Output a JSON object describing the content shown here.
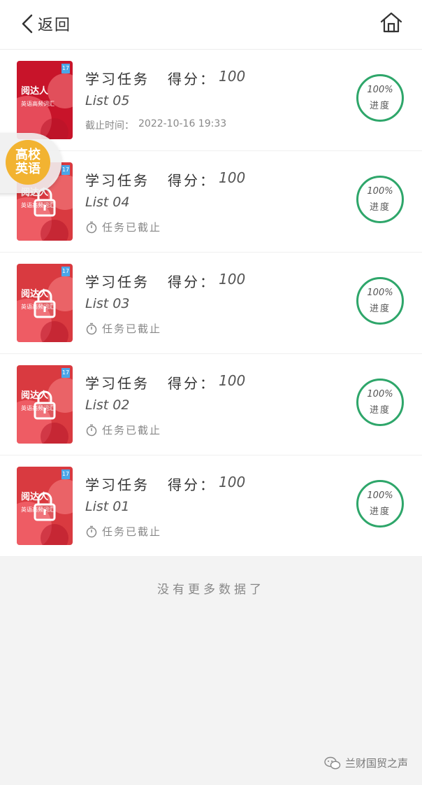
{
  "header": {
    "back_label": "返回"
  },
  "badge": {
    "line1": "高校",
    "line2": "英语"
  },
  "cover": {
    "brand": "阅达人",
    "subtitle": "英语高频词汇",
    "tag": "17"
  },
  "items": [
    {
      "title": "学习任务",
      "score_label": "得分：",
      "score_value": "100",
      "list_name": "List 05",
      "deadline_label": "截止时间：",
      "deadline_value": "2022-10-16 19:33",
      "progress_pct": "100%",
      "progress_label": "进度",
      "locked": false
    },
    {
      "title": "学习任务",
      "score_label": "得分：",
      "score_value": "100",
      "list_name": "List 04",
      "status": "任务已截止",
      "progress_pct": "100%",
      "progress_label": "进度",
      "locked": true
    },
    {
      "title": "学习任务",
      "score_label": "得分：",
      "score_value": "100",
      "list_name": "List 03",
      "status": "任务已截止",
      "progress_pct": "100%",
      "progress_label": "进度",
      "locked": true
    },
    {
      "title": "学习任务",
      "score_label": "得分：",
      "score_value": "100",
      "list_name": "List 02",
      "status": "任务已截止",
      "progress_pct": "100%",
      "progress_label": "进度",
      "locked": true
    },
    {
      "title": "学习任务",
      "score_label": "得分：",
      "score_value": "100",
      "list_name": "List 01",
      "status": "任务已截止",
      "progress_pct": "100%",
      "progress_label": "进度",
      "locked": true
    }
  ],
  "footer": {
    "no_more": "没有更多数据了"
  },
  "watermark": {
    "text": "兰财国贸之声"
  },
  "colors": {
    "progress_ring": "#2ea66a",
    "badge": "#f2b331",
    "cover_red": "#d93a40"
  }
}
